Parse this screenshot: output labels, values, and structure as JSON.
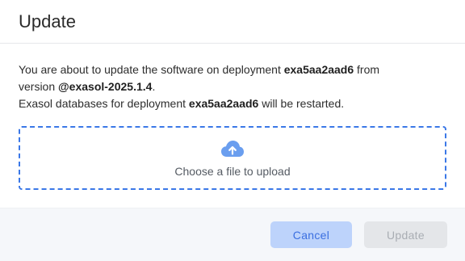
{
  "dialog": {
    "title": "Update",
    "message": {
      "line1_prefix": "You are about to update the software on deployment ",
      "deployment_id": "exa5aa2aad6",
      "line1_suffix": " from",
      "line2_prefix": "version ",
      "version": "@exasol-2025.1.4",
      "line2_suffix": ".",
      "line3_prefix": "Exasol databases for deployment ",
      "line3_deployment_id": "exa5aa2aad6",
      "line3_suffix": " will be restarted."
    },
    "dropzone": {
      "icon": "cloud-upload-icon",
      "text": "Choose a file to upload"
    },
    "buttons": {
      "cancel_label": "Cancel",
      "update_label": "Update"
    }
  },
  "colors": {
    "accent": "#3b78e7",
    "icon": "#6a9eef",
    "cancel_bg": "#bdd3fb",
    "update_disabled_bg": "#e4e6e9"
  }
}
